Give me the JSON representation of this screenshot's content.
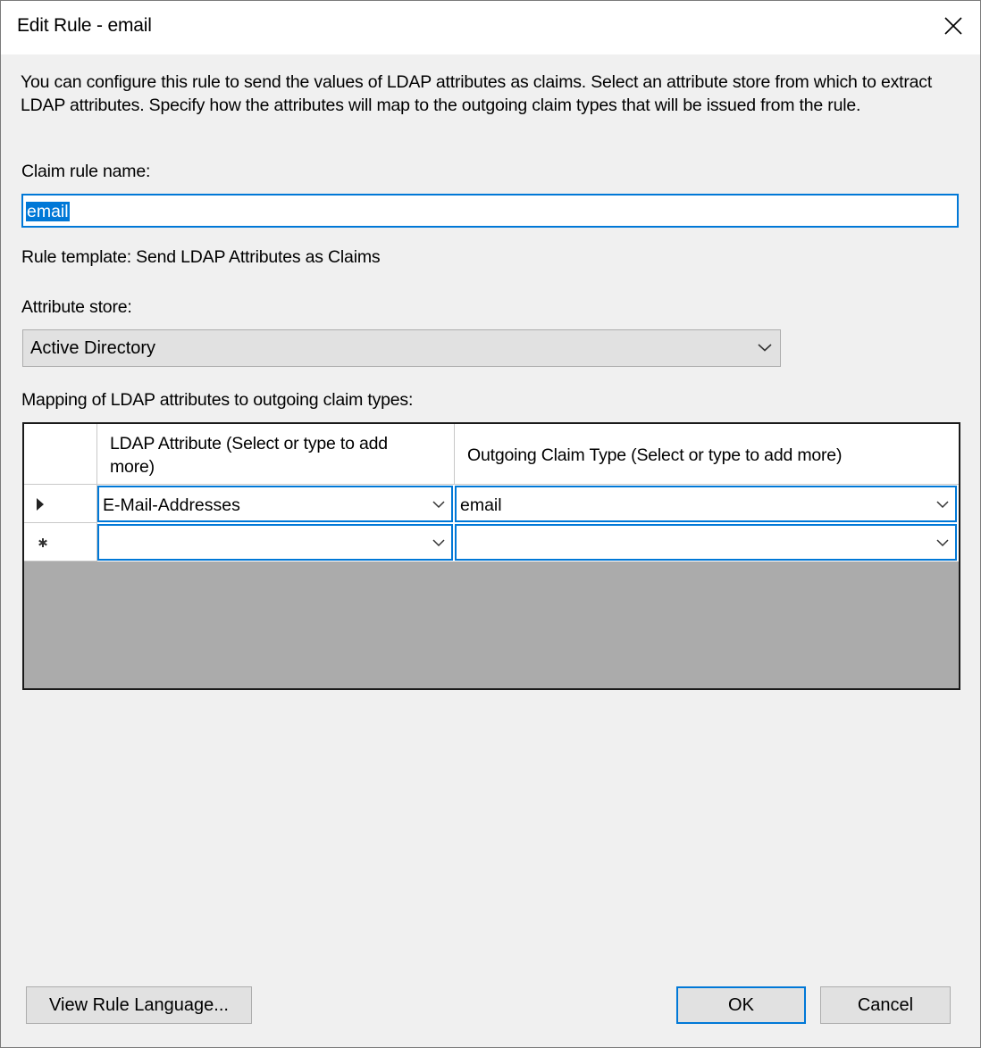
{
  "window": {
    "title": "Edit Rule - email",
    "close_icon": "close-icon"
  },
  "description": "You can configure this rule to send the values of LDAP attributes as claims. Select an attribute store from which to extract LDAP attributes. Specify how the attributes will map to the outgoing claim types that will be issued from the rule.",
  "claim_rule_name": {
    "label": "Claim rule name:",
    "value": "email"
  },
  "rule_template": "Rule template: Send LDAP Attributes as Claims",
  "attribute_store": {
    "label": "Attribute store:",
    "value": "Active Directory"
  },
  "mapping": {
    "label": "Mapping of LDAP attributes to outgoing claim types:",
    "columns": [
      "LDAP Attribute (Select or type to add more)",
      "Outgoing Claim Type (Select or type to add more)"
    ],
    "rows": [
      {
        "indicator": "current-row-arrow-icon",
        "ldap_attribute": "E-Mail-Addresses",
        "claim_type": "email"
      },
      {
        "indicator": "new-row-asterisk-icon",
        "ldap_attribute": "",
        "claim_type": ""
      }
    ]
  },
  "buttons": {
    "view_rule_language": "View Rule Language...",
    "ok": "OK",
    "cancel": "Cancel"
  },
  "colors": {
    "accent": "#0078d7",
    "dialog_bg": "#f0f0f0",
    "grid_empty_bg": "#ababab"
  }
}
